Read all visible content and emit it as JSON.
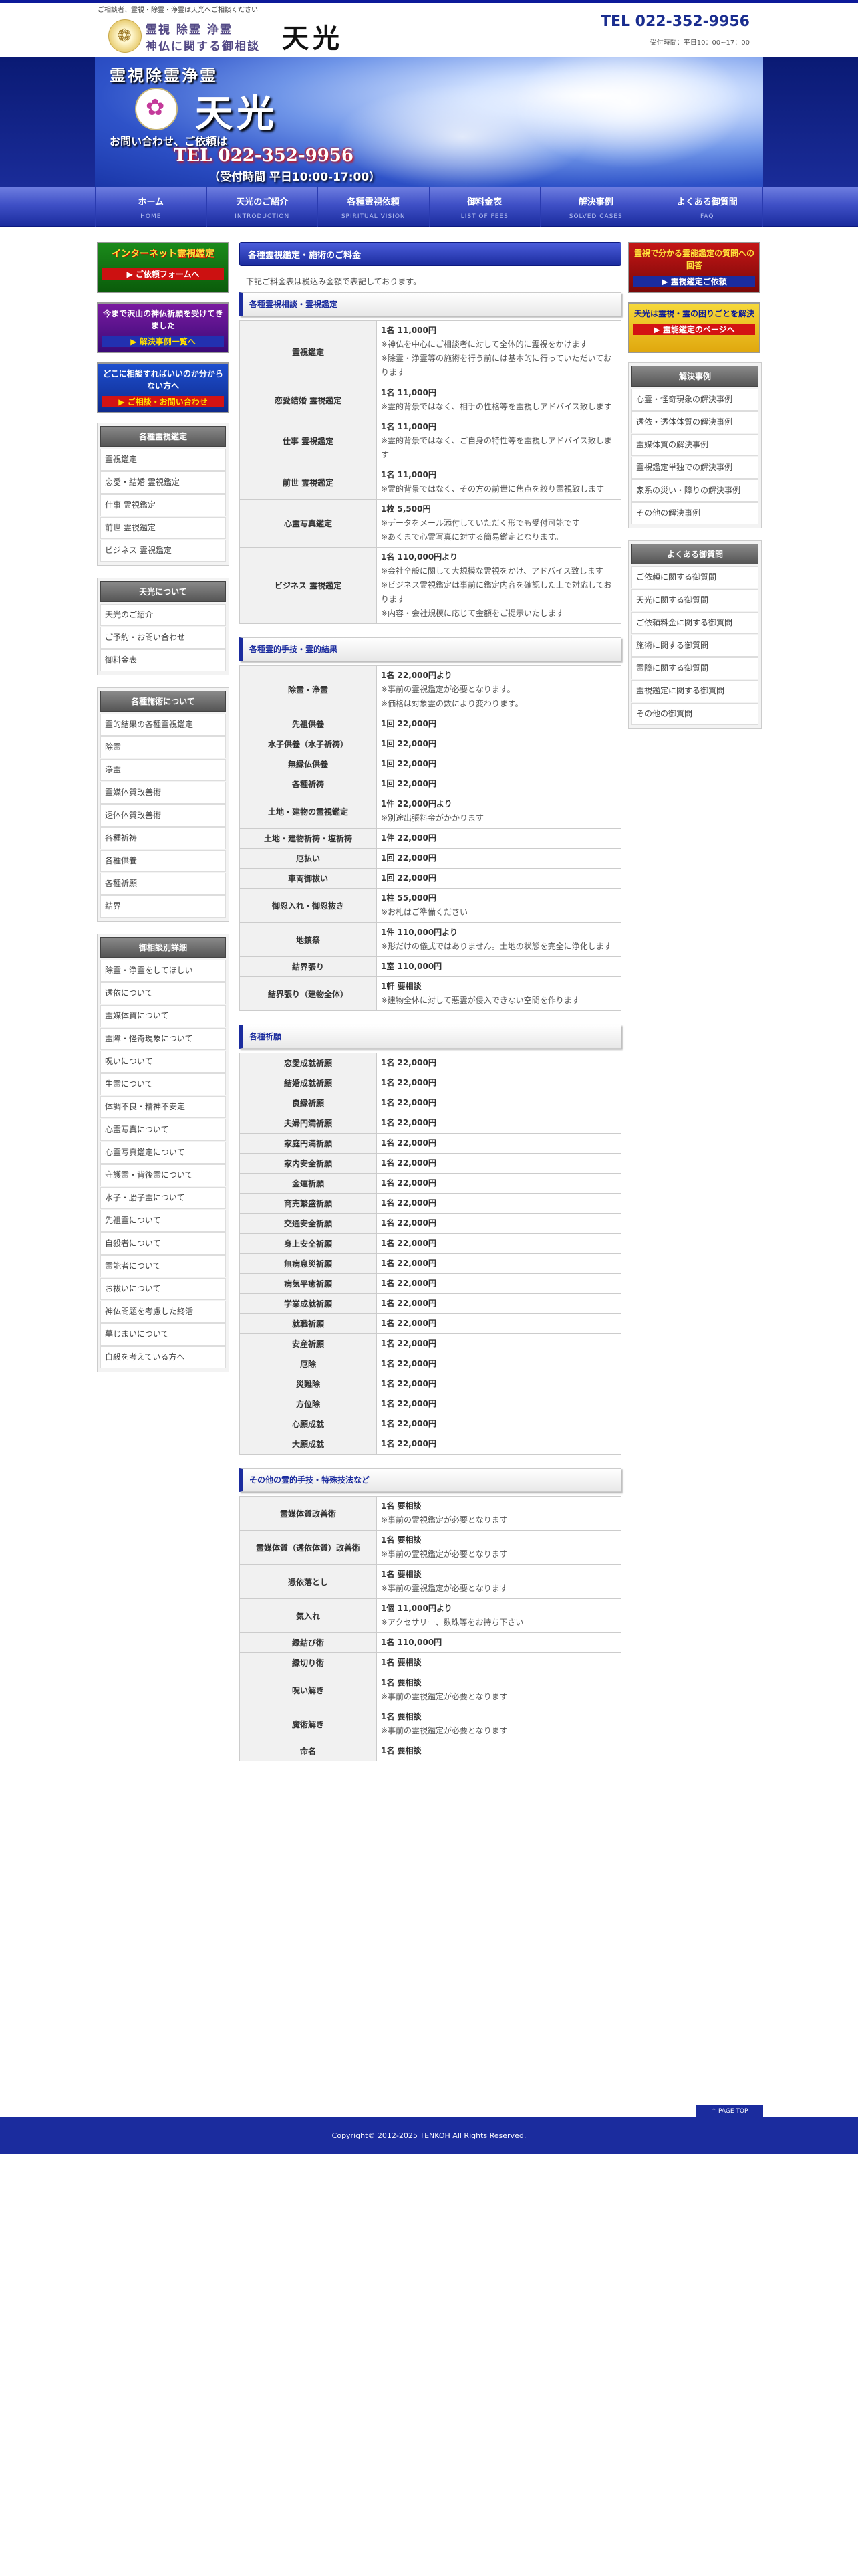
{
  "header": {
    "tagline": "ご相談者、霊視・除霊・浄霊は天光へご相談ください",
    "logo_small1": "霊視 除霊 浄霊",
    "logo_small2": "神仏に関する御相談",
    "logo_big": "天光",
    "tel": "TEL 022-352-9956",
    "hours": "受付時間：平日10：00~17：00",
    "mark_glyph": "❁"
  },
  "hero": {
    "title": "霊視除霊浄霊",
    "name": "天光",
    "contact": "お問い合わせ、ご依頼は",
    "tel": "TEL 022-352-9956",
    "hours": "（受付時間 平日10:00-17:00）",
    "emblem_glyph": "✿"
  },
  "nav": [
    {
      "label": "ホーム",
      "sub": "HOME"
    },
    {
      "label": "天光のご紹介",
      "sub": "INTRODUCTION"
    },
    {
      "label": "各種霊視依頼",
      "sub": "SPIRITUAL VISION"
    },
    {
      "label": "御料金表",
      "sub": "LIST OF FEES"
    },
    {
      "label": "解決事例",
      "sub": "SOLVED CASES"
    },
    {
      "label": "よくある御質問",
      "sub": "FAQ"
    }
  ],
  "left": {
    "banners": [
      {
        "l1": "インターネット霊視鑑定",
        "l2": "▶ ご依頼フォームへ"
      },
      {
        "l1": "今まで沢山の神仏祈願を受けてきました",
        "l2": "▶ 解決事例一覧へ"
      },
      {
        "l1": "どこに相談すればいいのか分からない方へ",
        "l2": "▶ ご相談・お問い合わせ"
      }
    ],
    "box1": {
      "title": "各種霊視鑑定",
      "items": [
        "霊視鑑定",
        "恋愛・結婚 霊視鑑定",
        "仕事 霊視鑑定",
        "前世 霊視鑑定",
        "ビジネス 霊視鑑定"
      ]
    },
    "box2": {
      "title": "天光について",
      "items": [
        "天光のご紹介",
        "ご予約・お問い合わせ",
        "御料金表"
      ]
    },
    "box3": {
      "title": "各種施術について",
      "items": [
        "霊的結果の各種霊視鑑定",
        "除霊",
        "浄霊",
        "霊媒体質改善術",
        "透体体質改善術",
        "各種祈祷",
        "各種供養",
        "各種祈願",
        "結界"
      ]
    },
    "box4": {
      "title": "御相談別詳細",
      "items": [
        "除霊・浄霊をしてほしい",
        "透依について",
        "霊媒体質について",
        "霊障・怪奇現象について",
        "呪いについて",
        "生霊について",
        "体調不良・精神不安定",
        "心霊写真について",
        "心霊写真鑑定について",
        "守護霊・背後霊について",
        "水子・胎子霊について",
        "先祖霊について",
        "自殺者について",
        "霊能者について",
        "お祓いについて",
        "神仏問題を考慮した終活",
        "墓じまいについて",
        "自殺を考えている方へ"
      ]
    }
  },
  "right": {
    "banners": [
      {
        "l1": "霊視で分かる霊能鑑定の質問への回答",
        "l2": "▶ 霊視鑑定ご依頼"
      },
      {
        "l1": "天光は霊視・霊の困りごとを解決",
        "l2": "▶ 霊能鑑定のページへ"
      }
    ],
    "box1": {
      "title": "解決事例",
      "items": [
        "心霊・怪奇現象の解決事例",
        "透依・透体体質の解決事例",
        "霊媒体質の解決事例",
        "霊視鑑定単独での解決事例",
        "家系の災い・障りの解決事例",
        "その他の解決事例"
      ]
    },
    "box2": {
      "title": "よくある御質問",
      "items": [
        "ご依頼に関する御質問",
        "天光に関する御質問",
        "ご依頼料金に関する御質問",
        "施術に関する御質問",
        "霊障に関する御質問",
        "霊視鑑定に関する御質問",
        "その他の御質問"
      ]
    }
  },
  "main": {
    "title": "各種霊視鑑定・施術のご料金",
    "intro": "下記ご料金表は税込み金額で表記しております。",
    "sections": [
      {
        "title": "各種霊視相談・霊視鑑定",
        "rows": [
          {
            "name": "霊視鑑定",
            "price": "1名 11,000円",
            "notes": [
              "※神仏を中心にご相談者に対して全体的に霊視をかけます",
              "※除霊・浄霊等の施術を行う前には基本的に行っていただいております"
            ]
          },
          {
            "name": "恋愛結婚 霊視鑑定",
            "price": "1名 11,000円",
            "notes": [
              "※霊的背景ではなく、相手の性格等を霊視しアドバイス致します"
            ]
          },
          {
            "name": "仕事 霊視鑑定",
            "price": "1名 11,000円",
            "notes": [
              "※霊的背景ではなく、ご自身の特性等を霊視しアドバイス致します"
            ]
          },
          {
            "name": "前世 霊視鑑定",
            "price": "1名 11,000円",
            "notes": [
              "※霊的背景ではなく、その方の前世に焦点を絞り霊視致します"
            ]
          },
          {
            "name": "心霊写真鑑定",
            "price": "1枚 5,500円",
            "notes": [
              "※データをメール添付していただく形でも受付可能です",
              "※あくまで心霊写真に対する簡易鑑定となります。"
            ]
          },
          {
            "name": "ビジネス 霊視鑑定",
            "price": "1名 110,000円より",
            "notes": [
              "※会社全般に関して大規模な霊視をかけ、アドバイス致します",
              "※ビジネス霊視鑑定は事前に鑑定内容を確認した上で対応しております",
              "※内容・会社規模に応じて金額をご提示いたします"
            ]
          }
        ]
      },
      {
        "title": "各種霊的手技・霊的結果",
        "rows": [
          {
            "name": "除霊・浄霊",
            "price": "1名 22,000円より",
            "notes": [
              "※事前の霊視鑑定が必要となります。",
              "※価格は対象霊の数により変わります。"
            ]
          },
          {
            "name": "先祖供養",
            "price": "1回 22,000円",
            "notes": []
          },
          {
            "name": "水子供養（水子祈祷）",
            "price": "1回 22,000円",
            "notes": []
          },
          {
            "name": "無縁仏供養",
            "price": "1回 22,000円",
            "notes": []
          },
          {
            "name": "各種祈祷",
            "price": "1回 22,000円",
            "notes": []
          },
          {
            "name": "土地・建物の霊視鑑定",
            "price": "1件 22,000円より",
            "notes": [
              "※別途出張料金がかかります"
            ]
          },
          {
            "name": "土地・建物祈祷・塩祈祷",
            "price": "1件 22,000円",
            "notes": []
          },
          {
            "name": "厄払い",
            "price": "1回 22,000円",
            "notes": []
          },
          {
            "name": "車両御祓い",
            "price": "1回 22,000円",
            "notes": []
          },
          {
            "name": "御忍入れ・御忍抜き",
            "price": "1柱 55,000円",
            "notes": [
              "※お札はご準備ください"
            ]
          },
          {
            "name": "地鎮祭",
            "price": "1件 110,000円より",
            "notes": [
              "※形だけの儀式ではありません。土地の状態を完全に浄化します"
            ]
          },
          {
            "name": "結界張り",
            "price": "1室 110,000円",
            "notes": []
          },
          {
            "name": "結界張り（建物全体）",
            "price": "1軒 要相談",
            "notes": [
              "※建物全体に対して悪霊が侵入できない空間を作ります"
            ]
          }
        ]
      },
      {
        "title": "各種祈願",
        "rows": [
          {
            "name": "恋愛成就祈願",
            "price": "1名 22,000円",
            "notes": []
          },
          {
            "name": "結婚成就祈願",
            "price": "1名 22,000円",
            "notes": []
          },
          {
            "name": "良縁祈願",
            "price": "1名 22,000円",
            "notes": []
          },
          {
            "name": "夫婦円満祈願",
            "price": "1名 22,000円",
            "notes": []
          },
          {
            "name": "家庭円満祈願",
            "price": "1名 22,000円",
            "notes": []
          },
          {
            "name": "家内安全祈願",
            "price": "1名 22,000円",
            "notes": []
          },
          {
            "name": "金運祈願",
            "price": "1名 22,000円",
            "notes": []
          },
          {
            "name": "商売繁盛祈願",
            "price": "1名 22,000円",
            "notes": []
          },
          {
            "name": "交通安全祈願",
            "price": "1名 22,000円",
            "notes": []
          },
          {
            "name": "身上安全祈願",
            "price": "1名 22,000円",
            "notes": []
          },
          {
            "name": "無病息災祈願",
            "price": "1名 22,000円",
            "notes": []
          },
          {
            "name": "病気平癒祈願",
            "price": "1名 22,000円",
            "notes": []
          },
          {
            "name": "学業成就祈願",
            "price": "1名 22,000円",
            "notes": []
          },
          {
            "name": "就職祈願",
            "price": "1名 22,000円",
            "notes": []
          },
          {
            "name": "安産祈願",
            "price": "1名 22,000円",
            "notes": []
          },
          {
            "name": "厄除",
            "price": "1名 22,000円",
            "notes": []
          },
          {
            "name": "災難除",
            "price": "1名 22,000円",
            "notes": []
          },
          {
            "name": "方位除",
            "price": "1名 22,000円",
            "notes": []
          },
          {
            "name": "心願成就",
            "price": "1名 22,000円",
            "notes": []
          },
          {
            "name": "大願成就",
            "price": "1名 22,000円",
            "notes": []
          }
        ]
      },
      {
        "title": "その他の霊的手技・特殊技法など",
        "rows": [
          {
            "name": "霊媒体質改善術",
            "price": "1名 要相談",
            "notes": [
              "※事前の霊視鑑定が必要となります"
            ]
          },
          {
            "name": "霊媒体質（透依体質）改善術",
            "price": "1名 要相談",
            "notes": [
              "※事前の霊視鑑定が必要となります"
            ]
          },
          {
            "name": "憑依落とし",
            "price": "1名 要相談",
            "notes": [
              "※事前の霊視鑑定が必要となります"
            ]
          },
          {
            "name": "気入れ",
            "price": "1個 11,000円より",
            "notes": [
              "※アクセサリー、数珠等をお持ち下さい"
            ]
          },
          {
            "name": "縁結び術",
            "price": "1名 110,000円",
            "notes": []
          },
          {
            "name": "縁切り術",
            "price": "1名 要相談",
            "notes": []
          },
          {
            "name": "呪い解き",
            "price": "1名 要相談",
            "notes": [
              "※事前の霊視鑑定が必要となります"
            ]
          },
          {
            "name": "魔術解き",
            "price": "1名 要相談",
            "notes": [
              "※事前の霊視鑑定が必要となります"
            ]
          },
          {
            "name": "命名",
            "price": "1名 要相談",
            "notes": []
          }
        ]
      }
    ]
  },
  "pagetop": "↑ PAGE TOP",
  "footer": "Copyright© 2012-2025 TENKOH All Rights Reserved."
}
